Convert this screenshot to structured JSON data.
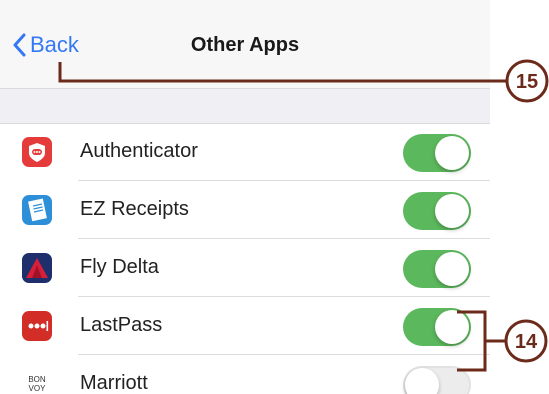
{
  "navbar": {
    "back_label": "Back",
    "title": "Other Apps"
  },
  "apps": [
    {
      "label": "Authenticator",
      "icon": "authenticator-icon",
      "enabled": true
    },
    {
      "label": "EZ Receipts",
      "icon": "ez-receipts-icon",
      "enabled": true
    },
    {
      "label": "Fly Delta",
      "icon": "fly-delta-icon",
      "enabled": true
    },
    {
      "label": "LastPass",
      "icon": "lastpass-icon",
      "enabled": true
    },
    {
      "label": "Marriott",
      "icon": "marriott-icon",
      "enabled": false
    }
  ],
  "marriott_logo": [
    "BON",
    "VOY"
  ],
  "callouts": [
    {
      "number": "15"
    },
    {
      "number": "14"
    }
  ],
  "colors": {
    "accent": "#3478f6",
    "toggle_on": "#5cb85c",
    "callout": "#6b2a1a"
  }
}
